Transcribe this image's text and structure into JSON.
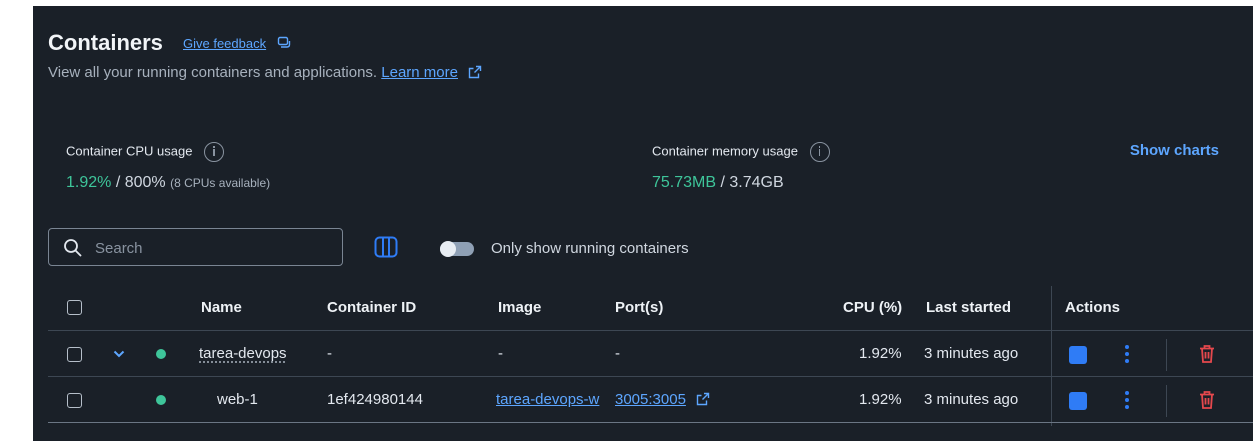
{
  "header": {
    "title": "Containers",
    "feedback_label": "Give feedback",
    "subtitle_text": "View all your running containers and applications.",
    "learn_more_label": "Learn more"
  },
  "stats": {
    "cpu": {
      "label": "Container CPU usage",
      "used": "1.92%",
      "total": "/ 800%",
      "note": "(8 CPUs available)"
    },
    "memory": {
      "label": "Container memory usage",
      "used": "75.73MB",
      "total": "/ 3.74GB"
    },
    "show_charts_label": "Show charts"
  },
  "toolbar": {
    "search_placeholder": "Search",
    "toggle_label": "Only show running containers",
    "toggle_on": false
  },
  "table": {
    "columns": [
      "Name",
      "Container ID",
      "Image",
      "Port(s)",
      "CPU (%)",
      "Last started",
      "Actions"
    ],
    "rows": [
      {
        "name": "tarea-devops",
        "container_id": "-",
        "image": "-",
        "ports": "-",
        "cpu": "1.92%",
        "last_started": "3 minutes ago"
      },
      {
        "name": "web-1",
        "container_id": "1ef424980144",
        "image": "tarea-devops-w",
        "ports": "3005:3005",
        "cpu": "1.92%",
        "last_started": "3 minutes ago"
      }
    ]
  },
  "colors": {
    "background": "#1a2028",
    "accent": "#2f7cf6",
    "link": "#5da6ff",
    "running": "#3ec59a",
    "danger": "#e5484d"
  },
  "icons": [
    "feedback-icon",
    "external-link-icon",
    "info-icon",
    "search-icon",
    "columns-icon",
    "chevron-down-icon",
    "status-running-icon",
    "stop-icon",
    "more-vertical-icon",
    "trash-icon"
  ]
}
